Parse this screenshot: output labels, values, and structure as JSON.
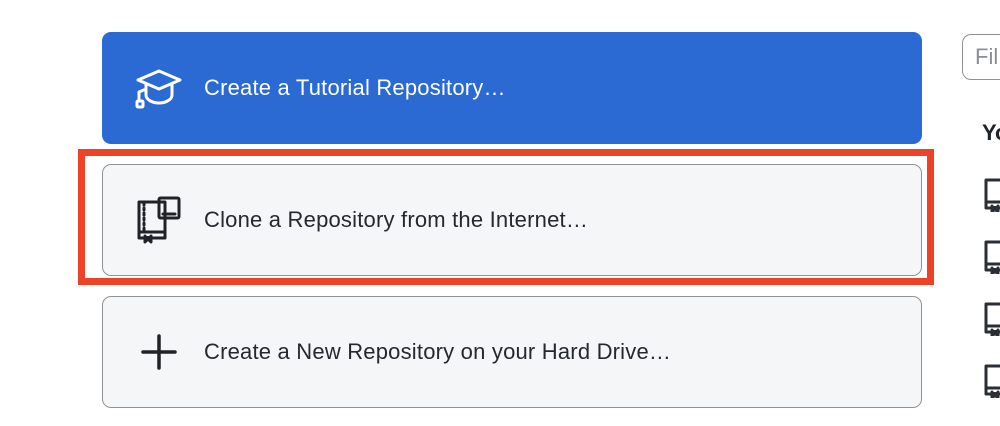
{
  "actions": {
    "tutorial": {
      "label": "Create a Tutorial Repository…",
      "icon": "mortarboard-icon"
    },
    "clone": {
      "label": "Clone a Repository from the Internet…",
      "icon": "desktop-download-icon"
    },
    "new_repo": {
      "label": "Create a New Repository on your Hard Drive…",
      "icon": "plus-icon"
    }
  },
  "sidebar": {
    "filter_placeholder": "Fil",
    "heading": "Yo",
    "repo_icon": "repo-icon"
  },
  "colors": {
    "primary": "#2a6ad2",
    "highlight": "#ec4327",
    "secondary_bg": "#f5f6f8"
  }
}
